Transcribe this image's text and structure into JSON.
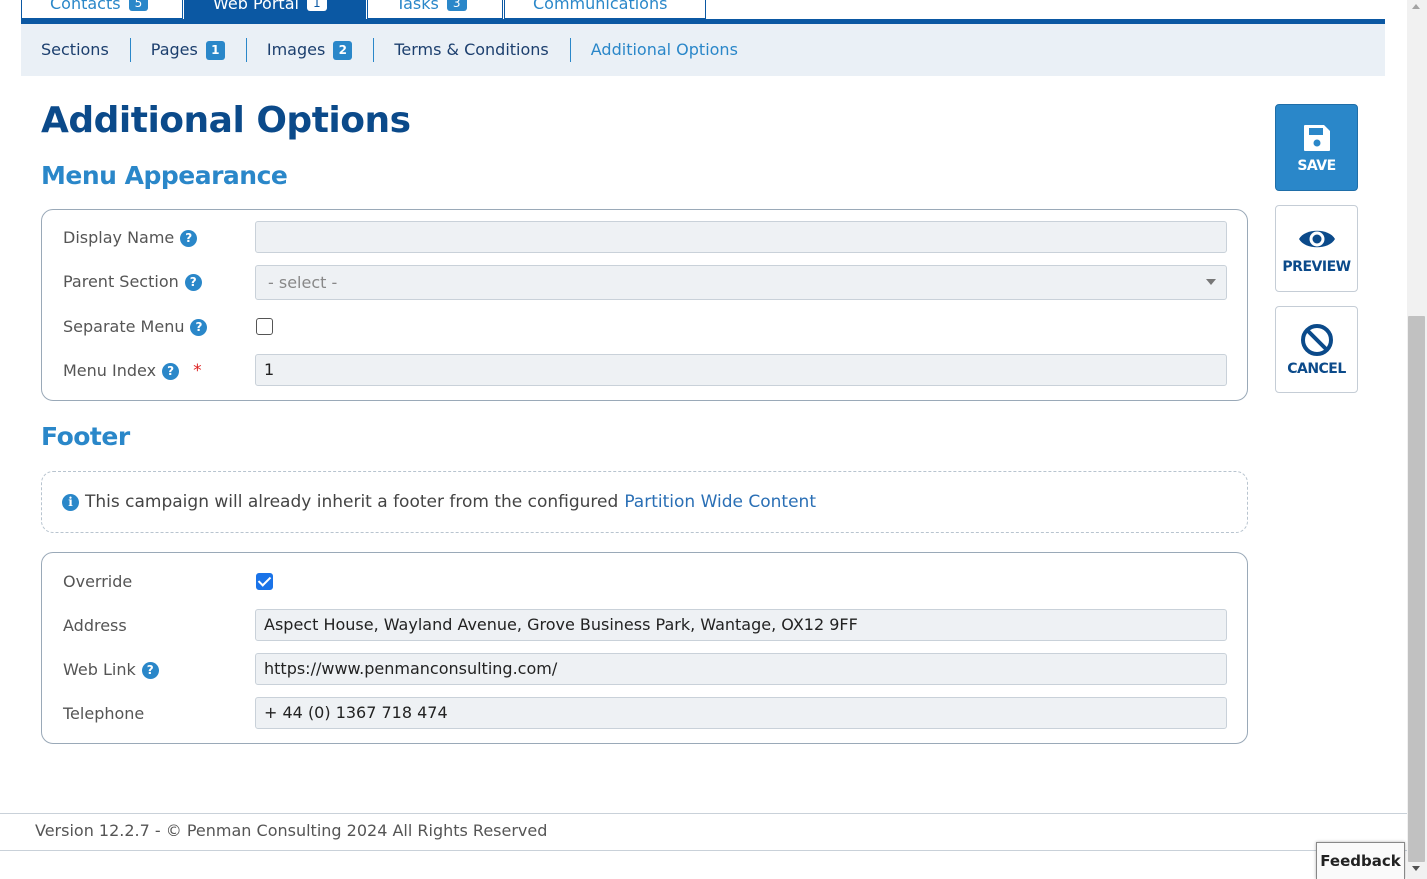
{
  "top_tabs": [
    {
      "label": "Contacts",
      "badge": "5",
      "active": false
    },
    {
      "label": "Web Portal",
      "badge": "1",
      "active": true
    },
    {
      "label": "Tasks",
      "badge": "3",
      "active": false
    },
    {
      "label": "Communications",
      "badge": "",
      "active": false
    }
  ],
  "subnav": {
    "sections": "Sections",
    "pages": "Pages",
    "pages_badge": "1",
    "images": "Images",
    "images_badge": "2",
    "terms": "Terms & Conditions",
    "additional": "Additional Options"
  },
  "page_title": "Additional Options",
  "menu_appearance": {
    "title": "Menu Appearance",
    "display_name_label": "Display Name",
    "display_name_value": "",
    "parent_section_label": "Parent Section",
    "parent_section_value": "- select -",
    "separate_menu_label": "Separate Menu",
    "separate_menu_checked": false,
    "menu_index_label": "Menu Index",
    "menu_index_required": "*",
    "menu_index_value": "1"
  },
  "footer_section": {
    "title": "Footer",
    "info_text": "This campaign will already inherit a footer from the configured",
    "info_link": "Partition Wide Content",
    "override_label": "Override",
    "override_checked": true,
    "address_label": "Address",
    "address_value": "Aspect House, Wayland Avenue, Grove Business Park, Wantage, OX12 9FF",
    "web_link_label": "Web Link",
    "web_link_value": "https://www.penmanconsulting.com/",
    "telephone_label": "Telephone",
    "telephone_value": "+ 44 (0) 1367 718 474"
  },
  "actions": {
    "save": "SAVE",
    "preview": "PREVIEW",
    "cancel": "CANCEL"
  },
  "help_glyph": "?",
  "info_glyph": "i",
  "footer_text": "Version 12.2.7 - © Penman Consulting 2024 All Rights Reserved",
  "feedback_label": "Feedback",
  "colors": {
    "primary": "#0b58a3",
    "accent": "#2a87c9",
    "title": "#0b4a8a"
  }
}
